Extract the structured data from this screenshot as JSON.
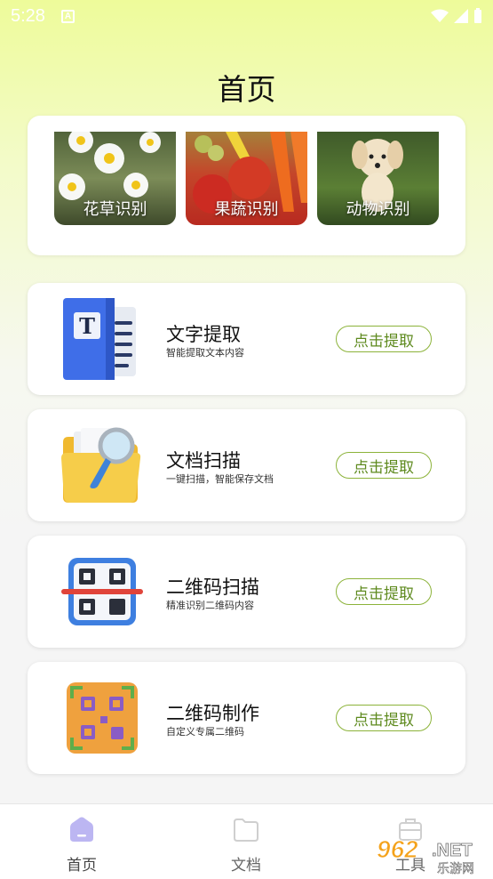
{
  "status_bar": {
    "time": "5:28",
    "app_icon": "A"
  },
  "header": {
    "title": "首页"
  },
  "categories": [
    {
      "label": "花草识别",
      "icon": "flower-photo"
    },
    {
      "label": "果蔬识别",
      "icon": "fruit-photo"
    },
    {
      "label": "动物识别",
      "icon": "dog-photo"
    }
  ],
  "features": [
    {
      "title": "文字提取",
      "subtitle": "智能提取文本内容",
      "button": "点击提取",
      "icon": "text-document-icon"
    },
    {
      "title": "文档扫描",
      "subtitle": "一键扫描，智能保存文档",
      "button": "点击提取",
      "icon": "folder-magnifier-icon"
    },
    {
      "title": "二维码扫描",
      "subtitle": "精准识别二维码内容",
      "button": "点击提取",
      "icon": "qr-scan-icon"
    },
    {
      "title": "二维码制作",
      "subtitle": "自定义专属二维码",
      "button": "点击提取",
      "icon": "qr-make-icon"
    }
  ],
  "bottom_nav": [
    {
      "label": "首页",
      "icon": "home-icon",
      "active": true
    },
    {
      "label": "文档",
      "icon": "folder-icon",
      "active": false
    },
    {
      "label": "工具",
      "icon": "toolbox-icon",
      "active": false
    }
  ],
  "watermark": {
    "main": "962.NET",
    "sub": "乐游网"
  },
  "colors": {
    "accent": "#8cb33a",
    "button_text": "#5e8a1e",
    "active_nav": "#b9b4f0"
  }
}
